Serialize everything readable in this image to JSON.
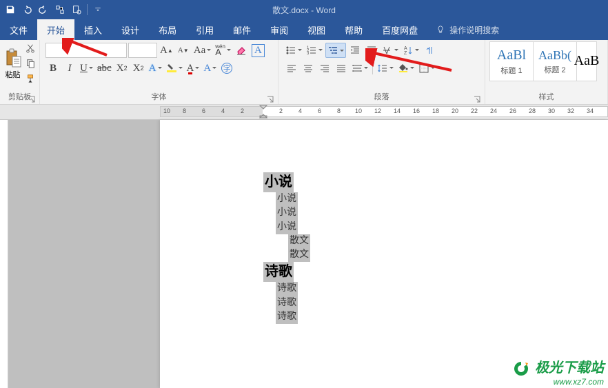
{
  "title": "散文.docx - Word",
  "tabs": {
    "file": "文件",
    "home": "开始",
    "insert": "插入",
    "design": "设计",
    "layout": "布局",
    "references": "引用",
    "mail": "邮件",
    "review": "审阅",
    "view": "视图",
    "help": "帮助",
    "baidu": "百度网盘",
    "tellme": "操作说明搜索"
  },
  "ribbon_labels": {
    "clipboard": "剪贴板",
    "font": "字体",
    "paragraph": "段落",
    "styles": "样式",
    "paste": "粘贴"
  },
  "font": {
    "name": "",
    "size": ""
  },
  "styles": [
    {
      "preview": "AaBl",
      "label": "标题 1",
      "cls": "h1"
    },
    {
      "preview": "AaBb(",
      "label": "标题 2",
      "cls": "h2"
    },
    {
      "preview": "AaB",
      "label": "",
      "cls": ""
    }
  ],
  "ruler_ticks": [
    "10",
    "8",
    "6",
    "4",
    "2",
    "",
    "2",
    "4",
    "6",
    "8",
    "10",
    "12",
    "14",
    "16",
    "18",
    "20",
    "22",
    "24",
    "26",
    "28",
    "30",
    "32",
    "34"
  ],
  "doc": {
    "h1": "小说",
    "p1": "小说",
    "p2": "小说",
    "p3": "小说",
    "p4": "散文",
    "p5": "散文",
    "h2": "诗歌",
    "p6": "诗歌",
    "p7": "诗歌",
    "p8": "诗歌"
  },
  "watermark": {
    "line1a": "O",
    "line1b": "极光下载站",
    "line2": "www.xz7.com"
  }
}
